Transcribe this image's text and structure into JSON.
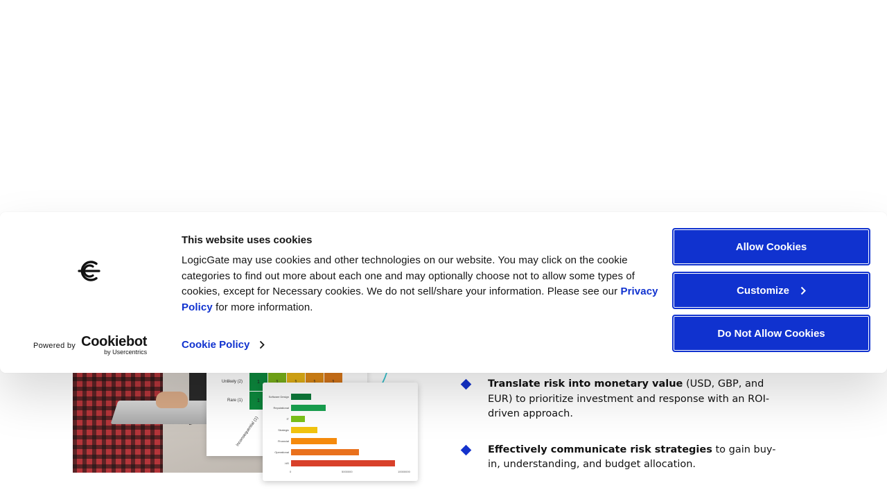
{
  "cookie_banner": {
    "title": "This website uses cookies",
    "body_text": "LogicGate may use cookies and other technologies on our website. You may click on the cookie categories to find out more about each one and may optionally choose not to allow some types of cookies, except for Necessary cookies.  We do not sell/share your information. Please see our ",
    "privacy_link": "Privacy Policy",
    "body_suffix": " for more information.",
    "cookie_policy_link": "Cookie Policy",
    "powered_by": "Powered by",
    "brand": "Cookiebot",
    "brand_sub": "by Usercentrics",
    "buttons": {
      "allow": "Allow Cookies",
      "customize": "Customize",
      "deny": "Do Not Allow Cookies"
    },
    "logo_icon": "logicgate-logo-icon",
    "accent_color": "#1032cf"
  },
  "hero": {
    "heatmap": {
      "row_labels": [
        "Unlikely (2)",
        "Rare (1)"
      ],
      "column_label": "Inconsequential (1)",
      "cells": [
        [
          "1",
          "1",
          "1",
          "1",
          "1"
        ],
        [
          "1",
          "",
          "",
          "",
          ""
        ]
      ]
    },
    "bar_chart": {
      "categories": [
        "Software Design",
        "Reputational",
        "IT",
        "Strategic",
        "Financial",
        "Operational",
        "HR"
      ],
      "colors": [
        "#0d7a3a",
        "#19a350",
        "#7bc21a",
        "#f2c40f",
        "#f58a0c",
        "#e9711d",
        "#d8402a"
      ],
      "ticks": [
        "0",
        "5000000",
        "10000000"
      ]
    }
  },
  "benefits": [
    {
      "bold": "Translate risk into monetary value",
      "text": " (USD, GBP, and EUR) to prioritize investment and response with an ROI-driven approach."
    },
    {
      "bold": "Effectively communicate risk strategies",
      "text": " to gain buy-in, understanding, and budget allocation."
    }
  ]
}
